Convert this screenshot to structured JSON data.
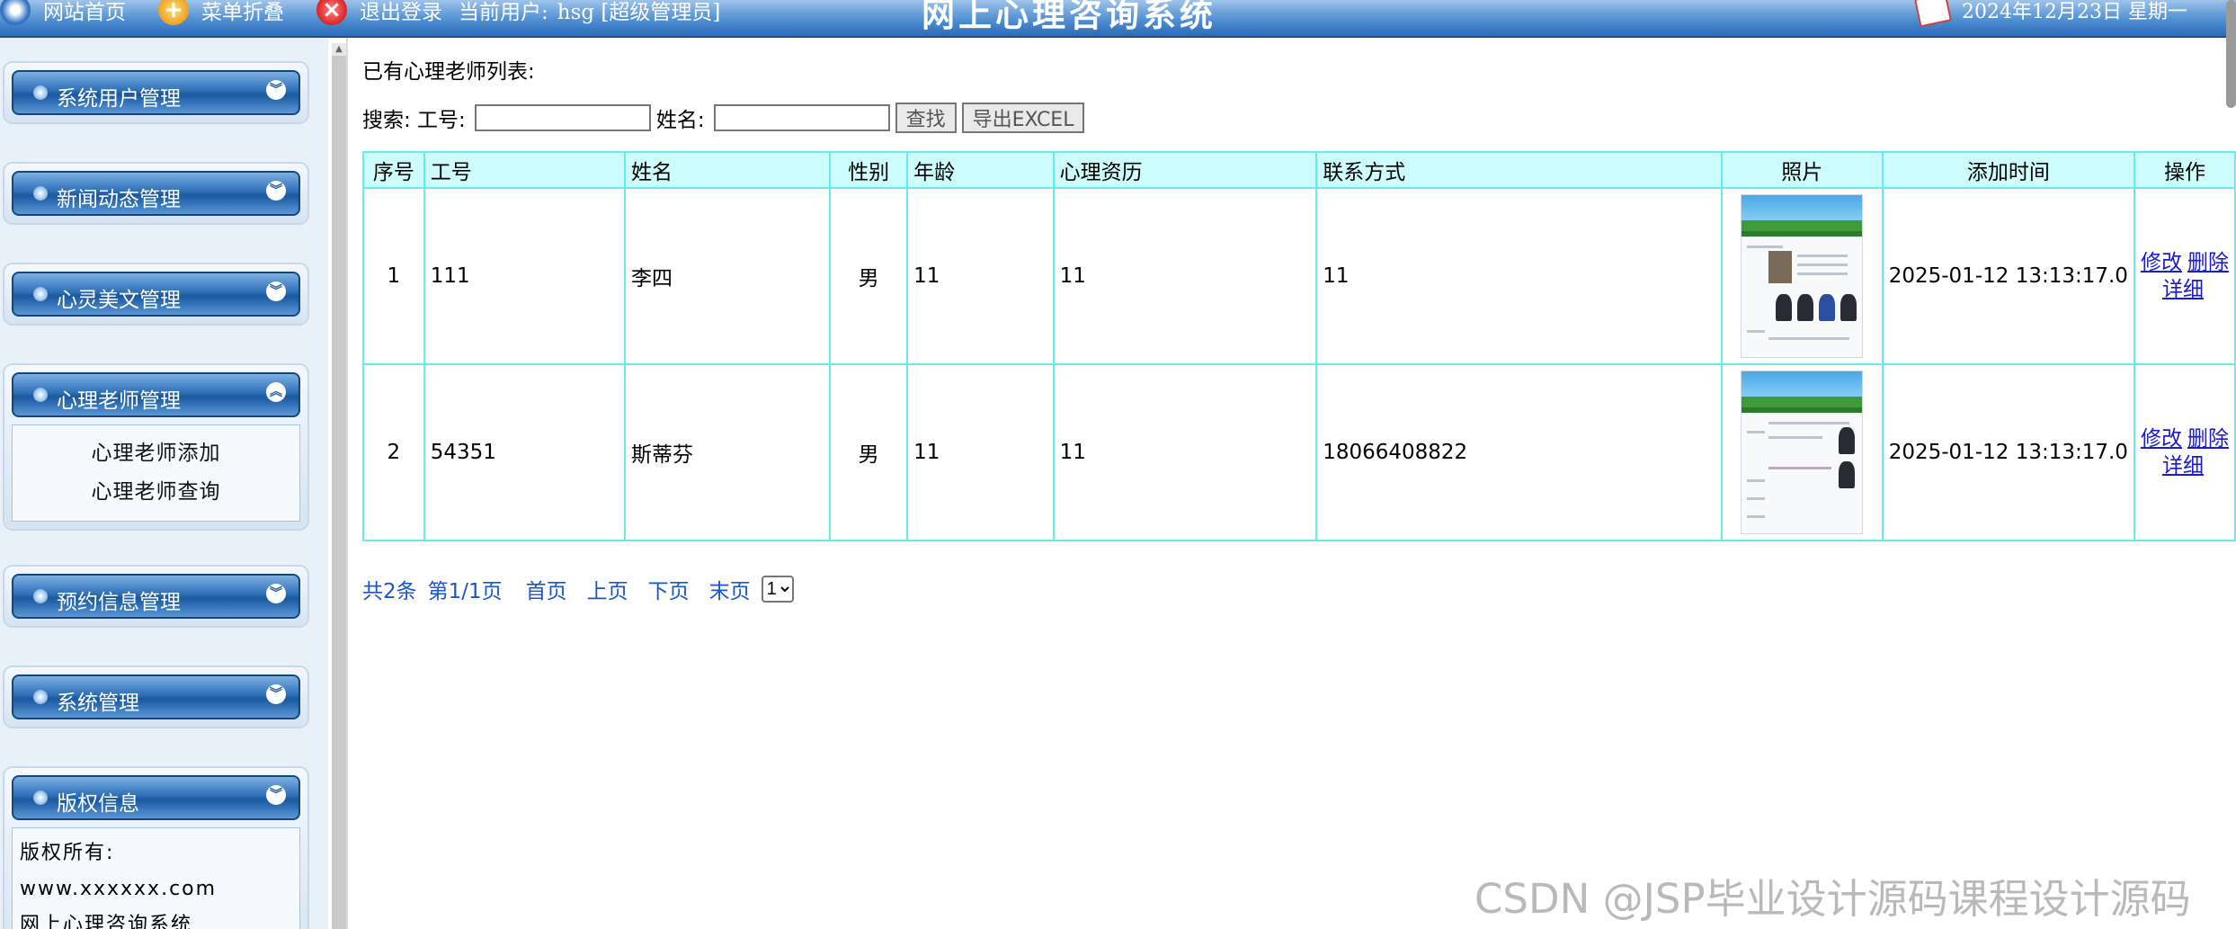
{
  "header": {
    "home": "网站首页",
    "menu_toggle": "菜单折叠",
    "logout": "退出登录",
    "current_user_label": "当前用户:",
    "current_user": "hsg [超级管理员]",
    "title": "网上心理咨询系统",
    "date": "2024年12月23日 星期一"
  },
  "sidebar": {
    "groups": [
      {
        "label": "系统用户管理",
        "chevron": "double-down"
      },
      {
        "label": "新闻动态管理",
        "chevron": "double-down"
      },
      {
        "label": "心灵美文管理",
        "chevron": "double-down"
      },
      {
        "label": "心理老师管理",
        "chevron": "double-up",
        "items": [
          "心理老师添加",
          "心理老师查询"
        ]
      },
      {
        "label": "预约信息管理",
        "chevron": "double-down"
      },
      {
        "label": "系统管理",
        "chevron": "double-down"
      },
      {
        "label": "版权信息",
        "chevron": "double-down",
        "copyright": [
          "版权所有:",
          "www.xxxxxx.com",
          "网上心理咨询系统"
        ]
      }
    ]
  },
  "main": {
    "list_title": "已有心理老师列表:",
    "search": {
      "label": "搜索: 工号:",
      "id_value": "",
      "name_label": "姓名:",
      "name_value": "",
      "find_button": "查找",
      "export_button": "导出EXCEL"
    },
    "table": {
      "columns": [
        "序号",
        "工号",
        "姓名",
        "性别",
        "年龄",
        "心理资历",
        "联系方式",
        "照片",
        "添加时间",
        "操作"
      ],
      "rows": [
        {
          "index": "1",
          "id": "111",
          "name": "李四",
          "gender": "男",
          "age": "11",
          "qualification": "11",
          "contact": "11",
          "time": "2025-01-12 13:13:17.0",
          "op_edit": "修改",
          "op_delete": "删除",
          "op_detail": "详细"
        },
        {
          "index": "2",
          "id": "54351",
          "name": "斯蒂芬",
          "gender": "男",
          "age": "11",
          "qualification": "11",
          "contact": "18066408822",
          "time": "2025-01-12 13:13:17.0",
          "op_edit": "修改",
          "op_delete": "删除",
          "op_detail": "详细"
        }
      ]
    },
    "pager": {
      "total": "共2条",
      "page": "第1/1页",
      "first": "首页",
      "prev": "上页",
      "next": "下页",
      "last": "末页",
      "selected_page": "1"
    }
  },
  "watermark": "CSDN @JSP毕业设计源码课程设计源码"
}
